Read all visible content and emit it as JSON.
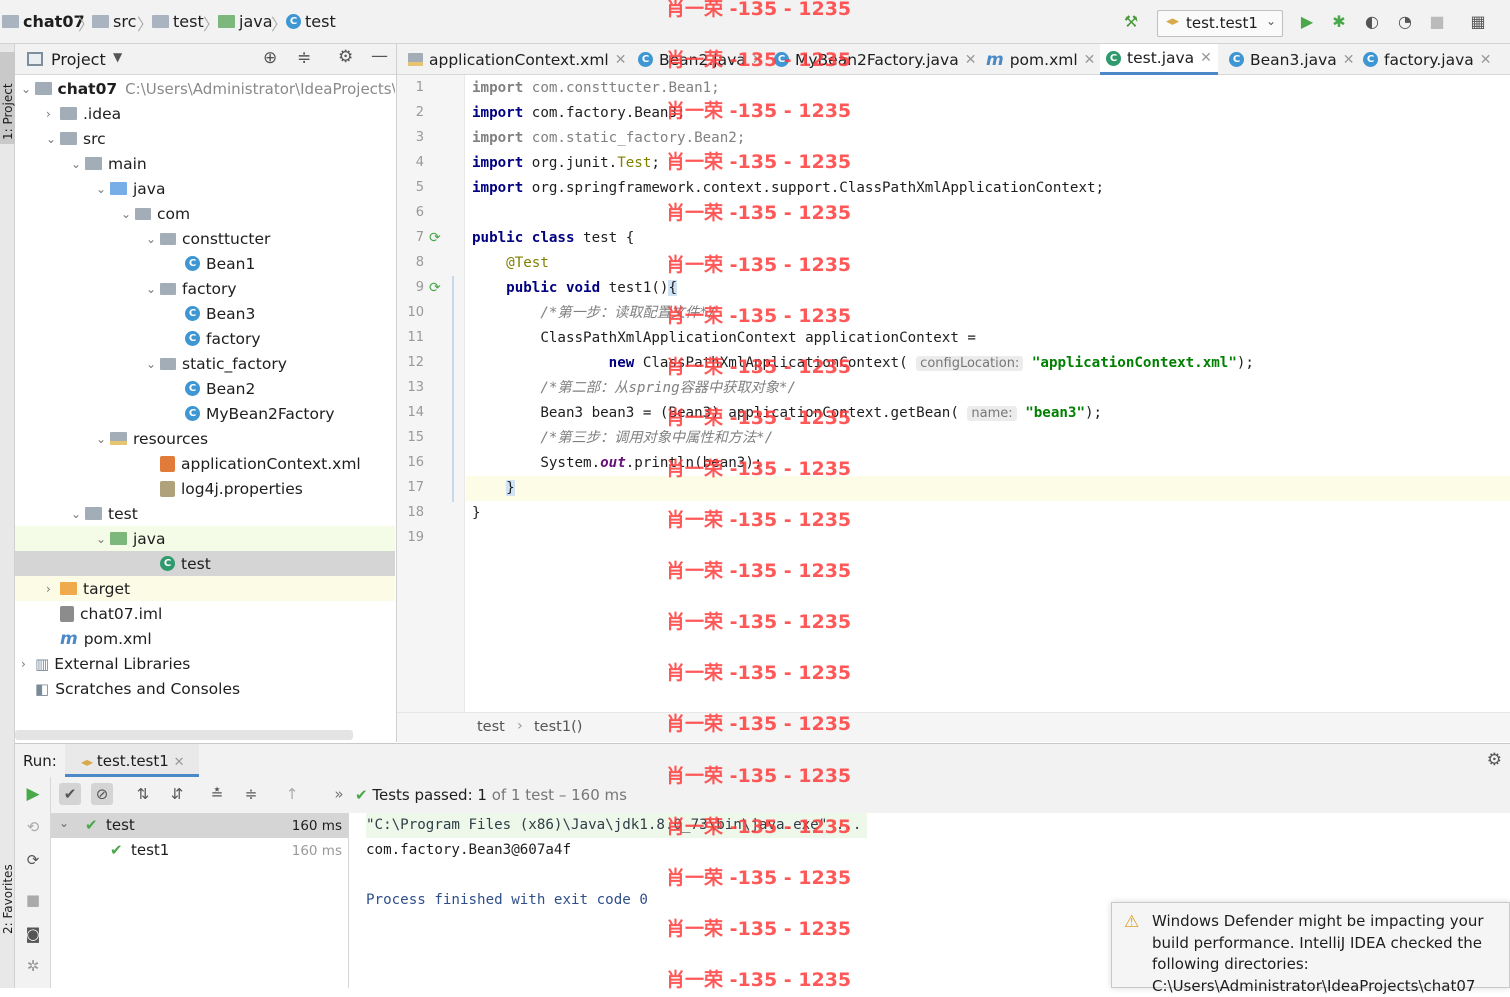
{
  "breadcrumb": {
    "project": "chat07",
    "items": [
      "src",
      "test",
      "java",
      "test"
    ]
  },
  "toolbar": {
    "run_config": "test.test1"
  },
  "project_panel": {
    "title": "Project",
    "project_path": "C:\\Users\\Administrator\\IdeaProjects\\c",
    "tree": [
      {
        "label": "chat07",
        "depth": 0,
        "arrow": "⌄",
        "icon": "folder",
        "bold": true
      },
      {
        "label": ".idea",
        "depth": 1,
        "arrow": "›",
        "icon": "folder"
      },
      {
        "label": "src",
        "depth": 1,
        "arrow": "⌄",
        "icon": "folder"
      },
      {
        "label": "main",
        "depth": 2,
        "arrow": "⌄",
        "icon": "folder"
      },
      {
        "label": "java",
        "depth": 3,
        "arrow": "⌄",
        "icon": "folder-blue"
      },
      {
        "label": "com",
        "depth": 4,
        "arrow": "⌄",
        "icon": "package"
      },
      {
        "label": "consttucter",
        "depth": 5,
        "arrow": "⌄",
        "icon": "package"
      },
      {
        "label": "Bean1",
        "depth": 6,
        "arrow": "",
        "icon": "class"
      },
      {
        "label": "factory",
        "depth": 5,
        "arrow": "⌄",
        "icon": "package"
      },
      {
        "label": "Bean3",
        "depth": 6,
        "arrow": "",
        "icon": "class"
      },
      {
        "label": "factory",
        "depth": 6,
        "arrow": "",
        "icon": "class"
      },
      {
        "label": "static_factory",
        "depth": 5,
        "arrow": "⌄",
        "icon": "package"
      },
      {
        "label": "Bean2",
        "depth": 6,
        "arrow": "",
        "icon": "class"
      },
      {
        "label": "MyBean2Factory",
        "depth": 6,
        "arrow": "",
        "icon": "class"
      },
      {
        "label": "resources",
        "depth": 3,
        "arrow": "⌄",
        "icon": "folder-res"
      },
      {
        "label": "applicationContext.xml",
        "depth": 5,
        "arrow": "",
        "icon": "xml"
      },
      {
        "label": "log4j.properties",
        "depth": 5,
        "arrow": "",
        "icon": "props"
      },
      {
        "label": "test",
        "depth": 2,
        "arrow": "⌄",
        "icon": "folder"
      },
      {
        "label": "java",
        "depth": 3,
        "arrow": "⌄",
        "icon": "folder-green"
      },
      {
        "label": "test",
        "depth": 5,
        "arrow": "",
        "icon": "test-class"
      },
      {
        "label": "target",
        "depth": 1,
        "arrow": "›",
        "icon": "folder-orange"
      },
      {
        "label": "chat07.iml",
        "depth": 1,
        "arrow": "",
        "icon": "iml"
      },
      {
        "label": "pom.xml",
        "depth": 1,
        "arrow": "",
        "icon": "maven"
      },
      {
        "label": "External Libraries",
        "depth": 0,
        "arrow": "›",
        "icon": "libs"
      },
      {
        "label": "Scratches and Consoles",
        "depth": 0,
        "arrow": "",
        "icon": "scratch"
      }
    ]
  },
  "tabs": [
    "applicationContext.xml",
    "Bean2.java",
    "MyBean2Factory.java",
    "pom.xml",
    "test.java",
    "Bean3.java",
    "factory.java"
  ],
  "editor": {
    "line_numbers": [
      "1",
      "2",
      "3",
      "4",
      "5",
      "6",
      "7",
      "8",
      "9",
      "10",
      "11",
      "12",
      "13",
      "14",
      "15",
      "16",
      "17",
      "18",
      "19"
    ],
    "hints": {
      "config": "configLocation:",
      "name": "name:"
    },
    "crumb": [
      "test",
      "test1()"
    ]
  },
  "run": {
    "label": "Run:",
    "tab": "test.test1",
    "status_prefix": "Tests passed: ",
    "passed": "1",
    "status_suffix": " of 1 test – 160 ms",
    "tests": [
      {
        "name": "test",
        "time": "160 ms"
      },
      {
        "name": "test1",
        "time": "160 ms"
      }
    ],
    "console": [
      "\"C:\\Program Files (x86)\\Java\\jdk1.8.0_73\\bin\\java.exe\" ...",
      "com.factory.Bean3@607a4f",
      "",
      "Process finished with exit code 0"
    ]
  },
  "notification": {
    "text": "Windows Defender might be impacting your build performance. IntelliJ IDEA checked the following directories:",
    "path": "C:\\Users\\Administrator\\IdeaProjects\\chat07"
  },
  "side_tabs": {
    "project": "1: Project",
    "favorites": "2: Favorites"
  },
  "watermark": "肖一荣 -135 - 1235"
}
